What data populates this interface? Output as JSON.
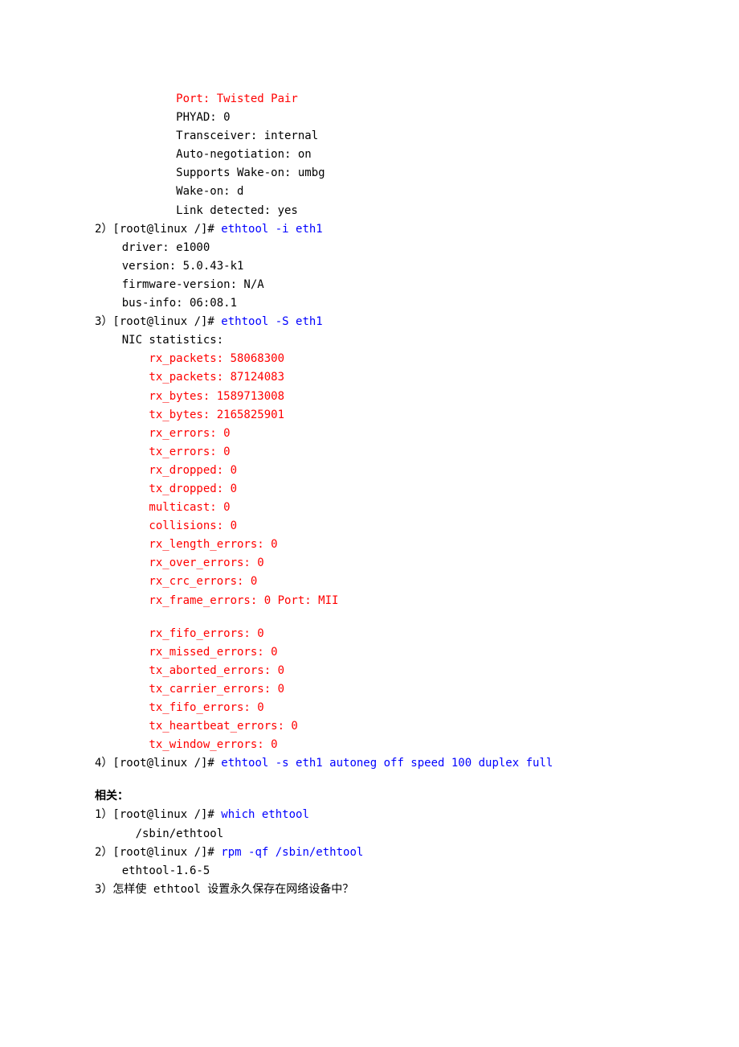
{
  "l1": "            Port: Twisted Pair",
  "l2": "            PHYAD: 0",
  "l3": "            Transceiver: internal",
  "l4": "            Auto-negotiation: on",
  "l5": "            Supports Wake-on: umbg",
  "l6": "            Wake-on: d",
  "l7": "            Link detected: yes",
  "l8a": "2）[root@linux /]# ",
  "l8b": "ethtool -i eth1",
  "l9": "    driver: e1000",
  "l10": "    version: 5.0.43-k1",
  "l11": "    firmware-version: N/A",
  "l12": "    bus-info: 06:08.1",
  "l13a": "3）[root@linux /]# ",
  "l13b": "ethtool -S eth1",
  "l14": "    NIC statistics:",
  "l15": "        rx_packets: 58068300",
  "l16": "        tx_packets: 87124083",
  "l17": "        rx_bytes: 1589713008",
  "l18": "        tx_bytes: 2165825901",
  "l19": "        rx_errors: 0",
  "l20": "        tx_errors: 0",
  "l21": "        rx_dropped: 0",
  "l22": "        tx_dropped: 0",
  "l23": "        multicast: 0",
  "l24": "        collisions: 0",
  "l25": "        rx_length_errors: 0",
  "l26": "        rx_over_errors: 0",
  "l27": "        rx_crc_errors: 0",
  "l28": "        rx_frame_errors: 0 Port: MII",
  "l29": "        rx_fifo_errors: 0",
  "l30": "        rx_missed_errors: 0",
  "l31": "        tx_aborted_errors: 0",
  "l32": "        tx_carrier_errors: 0",
  "l33": "        tx_fifo_errors: 0",
  "l34": "        tx_heartbeat_errors: 0",
  "l35": "        tx_window_errors: 0",
  "l36a": "4）[root@linux /]# ",
  "l36b": "ethtool -s eth1 autoneg off speed 100 duplex full",
  "h2": "相关：",
  "r1a": "1）[root@linux /]# ",
  "r1b": "which ethtool",
  "r2": "      /sbin/ethtool",
  "r3a": "2）[root@linux /]# ",
  "r3b": "rpm -qf /sbin/ethtool",
  "r4": "    ethtool-1.6-5",
  "r5": "3）怎样使 ethtool 设置永久保存在网络设备中？"
}
